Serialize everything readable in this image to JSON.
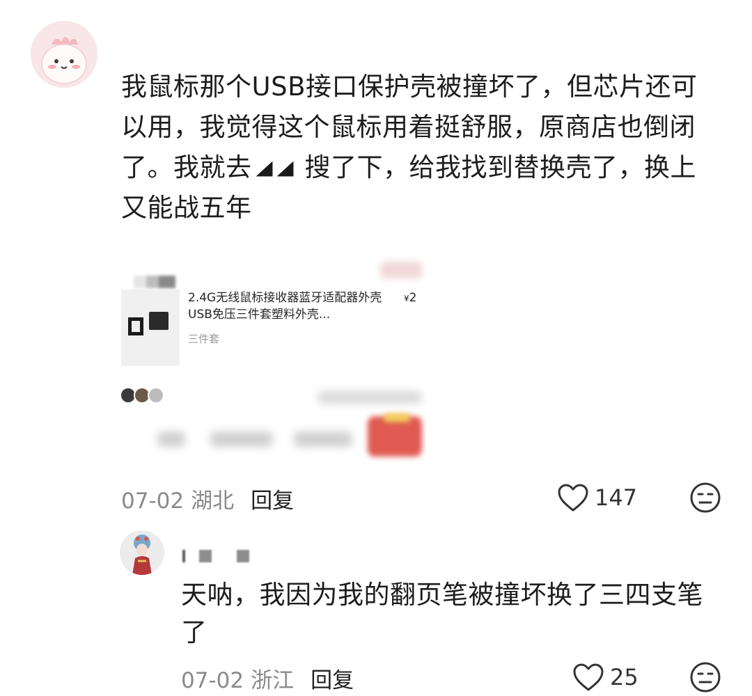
{
  "main_comment": {
    "text_part1": "我鼠标那个USB接口保护壳被撞坏了，但芯片还可以用，我觉得这个鼠标用着挺舒服，原商店也倒闭了。我就去",
    "text_part2": "搜了下，给我找到替换壳了，换上又能战五年",
    "date": "07-02",
    "region": "湖北",
    "reply_label": "回复",
    "like_count": "147"
  },
  "product_card": {
    "title": "2.4G无线鼠标接收器蓝牙适配器外壳USB免压三件套塑料外壳...",
    "price_symbol": "¥",
    "price": "2",
    "spec": "三件套"
  },
  "reply_comment": {
    "text": "天呐，我因为我的翻页笔被撞坏换了三四支笔了",
    "date": "07-02",
    "region": "浙江",
    "reply_label": "回复",
    "like_count": "25"
  },
  "icons": {
    "like": "heart-outline-icon",
    "dislike": "meh-face-icon"
  },
  "colors": {
    "text_primary": "#1d1d1d",
    "text_meta": "#8a8a8a",
    "avatar_pink": "#f7e4e6"
  }
}
